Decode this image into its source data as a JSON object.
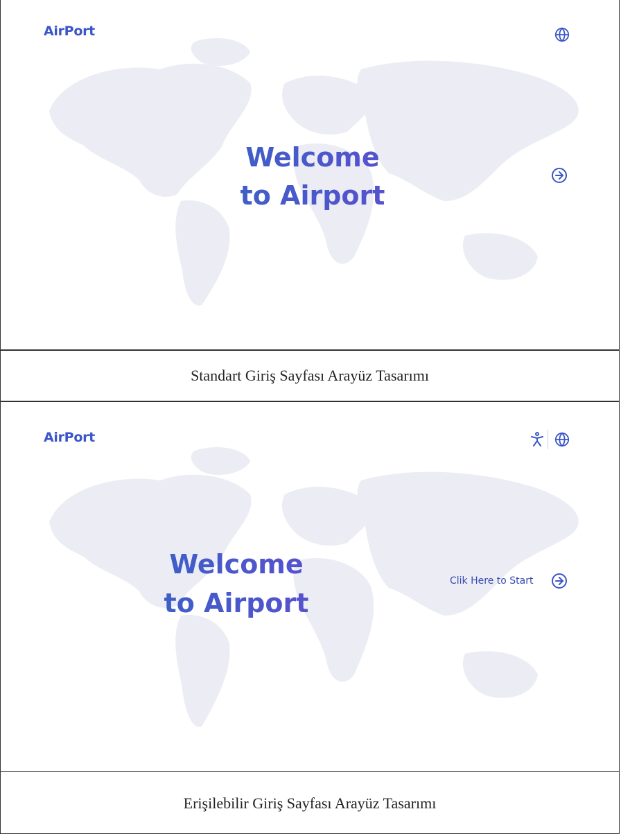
{
  "standard": {
    "logo": "AirPort",
    "welcome_line1": "Welcome",
    "welcome_line2": "to Airport",
    "caption": "Standart Giriş Sayfası Arayüz Tasarımı"
  },
  "accessible": {
    "logo": "AirPort",
    "welcome_line1": "Welcome",
    "welcome_line2": "to Airport",
    "start_label": "Clik Here to Start",
    "caption": "Erişilebilir Giriş Sayfası Arayüz Tasarımı"
  },
  "icons": [
    "globe-icon",
    "arrow-right-circle-icon",
    "accessibility-icon",
    "world-map"
  ],
  "colors": {
    "brand": "#3b56c7",
    "gradient_start": "#3a61c6",
    "gradient_end": "#5b4fd0",
    "map": "#ecedf4"
  }
}
